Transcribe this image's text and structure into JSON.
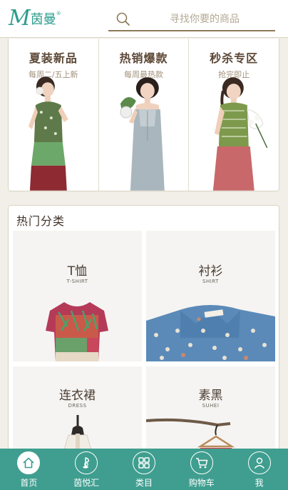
{
  "header": {
    "logo_letter": "M",
    "logo_text": "茵曼",
    "logo_reg": "®",
    "search_placeholder": "寻找你要的商品"
  },
  "promos": [
    {
      "title": "夏装新品",
      "subtitle": "每周二/五上新"
    },
    {
      "title": "热销爆款",
      "subtitle": "每周最热款"
    },
    {
      "title": "秒杀专区",
      "subtitle": "抢完即止"
    }
  ],
  "categories": {
    "title": "热门分类",
    "items": [
      {
        "cn": "T恤",
        "en": "T-SHIRT"
      },
      {
        "cn": "衬衫",
        "en": "SHIRT"
      },
      {
        "cn": "连衣裙",
        "en": "DRESS"
      },
      {
        "cn": "素黑",
        "en": "SUHEI"
      }
    ]
  },
  "nav": {
    "items": [
      {
        "label": "首页",
        "icon": "home-icon",
        "active": true
      },
      {
        "label": "茵悦汇",
        "icon": "music-note-icon",
        "active": false
      },
      {
        "label": "类目",
        "icon": "grid-icon",
        "active": false
      },
      {
        "label": "购物车",
        "icon": "cart-icon",
        "active": false
      },
      {
        "label": "我",
        "icon": "user-icon",
        "active": false
      }
    ]
  },
  "colors": {
    "brand": "#2c9c8c",
    "nav_bg": "#3f9e8f",
    "page_bg": "#f1efe7",
    "title_brown": "#5c4836",
    "subtitle_tan": "#a2917a"
  }
}
